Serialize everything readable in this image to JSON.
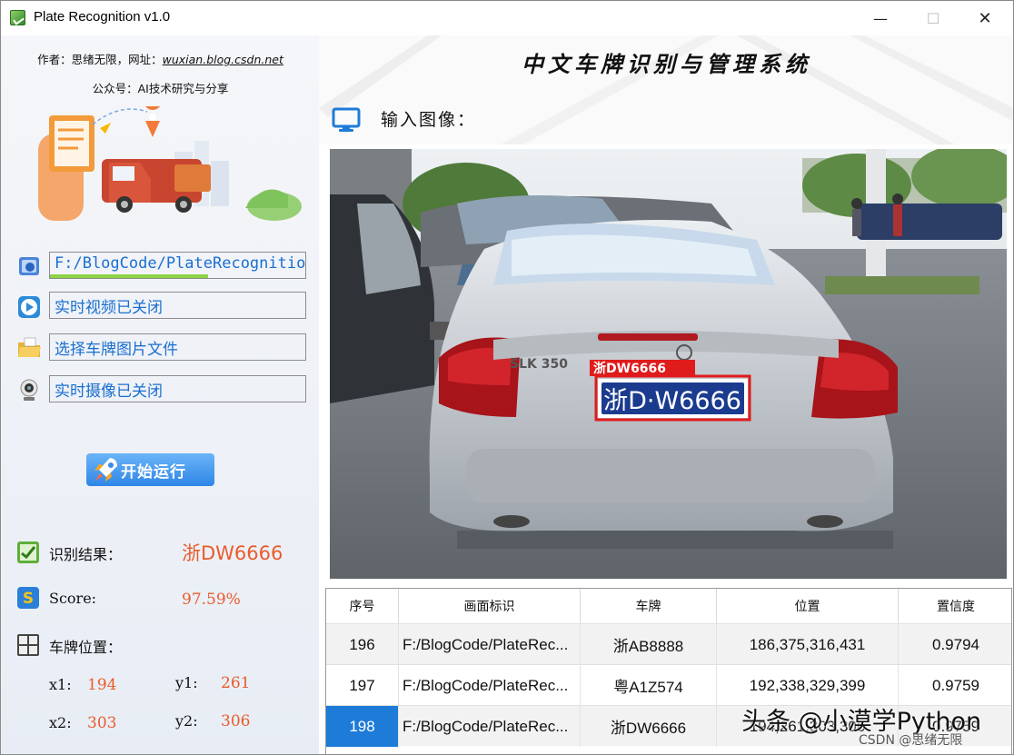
{
  "window": {
    "title": "Plate Recognition v1.0",
    "minimize": "—",
    "maximize": "☐",
    "close": "✕"
  },
  "left": {
    "author_prefix": "作者：思绪无限，网址：",
    "author_link": "wuxian.blog.csdn.net",
    "public_account": "公众号：AI技术研究与分享",
    "path_field": "F:/BlogCode/PlateRecognition",
    "video_field": "实时视频已关闭",
    "select_field": "选择车牌图片文件",
    "camera_field": "实时摄像已关闭",
    "start_button": "开始运行",
    "result_label": "识别结果：",
    "result_value": "浙DW6666",
    "score_label": "Score:",
    "score_value": "97.59%",
    "position_label": "车牌位置：",
    "x1_label": "x1:",
    "x1_value": "194",
    "y1_label": "y1:",
    "y1_value": "261",
    "x2_label": "x2:",
    "x2_value": "303",
    "y2_label": "y2:",
    "y2_value": "306"
  },
  "right": {
    "system_title": "中文车牌识别与管理系统",
    "input_label": "输入图像：",
    "detection_label": "浙DW6666",
    "plate_text": "浙D·W6666",
    "car_badge": "SLK 350"
  },
  "table": {
    "headers": [
      "序号",
      "画面标识",
      "车牌",
      "位置",
      "置信度"
    ],
    "rows": [
      [
        "196",
        "F:/BlogCode/PlateRec...",
        "浙AB8888",
        "186,375,316,431",
        "0.9794"
      ],
      [
        "197",
        "F:/BlogCode/PlateRec...",
        "粤A1Z574",
        "192,338,329,399",
        "0.9759"
      ],
      [
        "198",
        "F:/BlogCode/PlateRec...",
        "浙DW6666",
        "194,261,303,306",
        "0.9759"
      ]
    ]
  },
  "overlay": {
    "watermark": "头条 @小漠学Python",
    "csdn": "CSDN @思绪无限"
  },
  "colors": {
    "accent_blue": "#1e7bd8",
    "result_red": "#ea5b2c",
    "path_text": "#1a6fd0",
    "progress_green": "#8ed443"
  }
}
